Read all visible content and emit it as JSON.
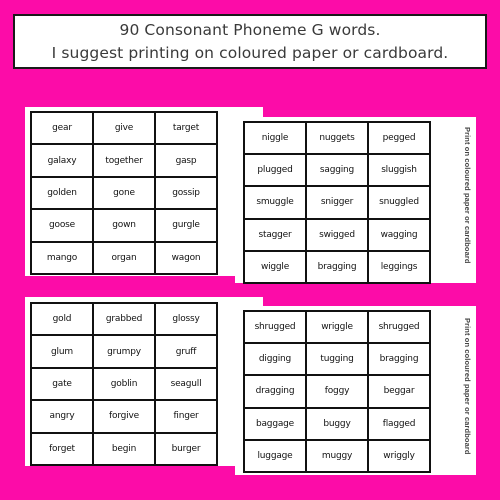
{
  "header": {
    "line1": "90 Consonant Phoneme G words.",
    "line2": "I suggest printing on coloured paper or cardboard."
  },
  "colors": {
    "background": "#fc0ca8",
    "card": "#ffffff",
    "grid_lines": "#111111",
    "header_text": "#3a3a3a"
  },
  "cards": [
    {
      "position": "top-left",
      "words": [
        [
          "gear",
          "give",
          "target"
        ],
        [
          "galaxy",
          "together",
          "gasp"
        ],
        [
          "golden",
          "gone",
          "gossip"
        ],
        [
          "goose",
          "gown",
          "gurgle"
        ],
        [
          "mango",
          "organ",
          "wagon"
        ]
      ]
    },
    {
      "position": "top-right",
      "side_label": "Print on coloured paper or cardboard",
      "words": [
        [
          "niggle",
          "nuggets",
          "pegged"
        ],
        [
          "plugged",
          "sagging",
          "sluggish"
        ],
        [
          "smuggle",
          "snigger",
          "snuggled"
        ],
        [
          "stagger",
          "swigged",
          "wagging"
        ],
        [
          "wiggle",
          "bragging",
          "leggings"
        ]
      ]
    },
    {
      "position": "bottom-left",
      "words": [
        [
          "gold",
          "grabbed",
          "glossy"
        ],
        [
          "glum",
          "grumpy",
          "gruff"
        ],
        [
          "gate",
          "goblin",
          "seagull"
        ],
        [
          "angry",
          "forgive",
          "finger"
        ],
        [
          "forget",
          "begin",
          "burger"
        ]
      ]
    },
    {
      "position": "bottom-right",
      "side_label": "Print on coloured paper or cardboard",
      "words": [
        [
          "shrugged",
          "wriggle",
          "shrugged"
        ],
        [
          "digging",
          "tugging",
          "bragging"
        ],
        [
          "dragging",
          "foggy",
          "beggar"
        ],
        [
          "baggage",
          "buggy",
          "flagged"
        ],
        [
          "luggage",
          "muggy",
          "wriggly"
        ]
      ]
    }
  ]
}
